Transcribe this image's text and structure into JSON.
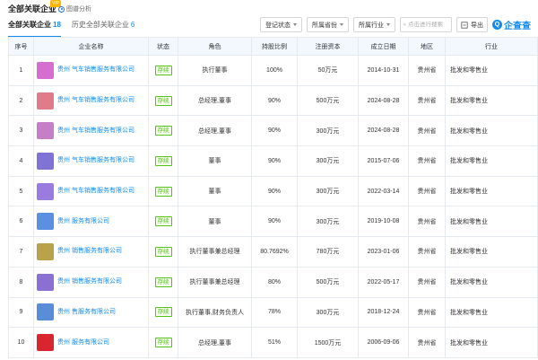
{
  "header": {
    "title": "全部关联企业",
    "vip_badge": "VIP",
    "analysis_label": "图谱分析"
  },
  "tabs": [
    {
      "label": "全部关联企业",
      "count": "18"
    },
    {
      "label": "历史全部关联企业",
      "count": "6"
    }
  ],
  "filters": {
    "status": "登记状态",
    "industry_all": "所属省份",
    "industry": "所属行业",
    "search_placeholder": "点击进行搜索",
    "export": "导出",
    "brand": "企查查"
  },
  "table": {
    "columns": [
      "序号",
      "企业名称",
      "状态",
      "角色",
      "持股比例",
      "注册资本",
      "成立日期",
      "地区",
      "行业"
    ],
    "rows": [
      {
        "no": "1",
        "name": "贵州                气车销售服务有限公司",
        "status": "存续",
        "role": "执行董事",
        "ratio": "100%",
        "capital": "50万元",
        "date": "2014-10-31",
        "region": "贵州省",
        "industry": "批发和零售业",
        "logo": "#d46fcf"
      },
      {
        "no": "2",
        "name": "贵州                气车销售服务有限公司",
        "status": "存续",
        "role": "总经理,董事",
        "ratio": "90%",
        "capital": "500万元",
        "date": "2024-08-28",
        "region": "贵州省",
        "industry": "批发和零售业",
        "logo": "#e07c8a"
      },
      {
        "no": "3",
        "name": "贵州                气车销售服务有限公司",
        "status": "存续",
        "role": "总经理,董事",
        "ratio": "90%",
        "capital": "300万元",
        "date": "2024-08-28",
        "region": "贵州省",
        "industry": "批发和零售业",
        "logo": "#c57fc9"
      },
      {
        "no": "4",
        "name": "贵州                气车销售服务有限公司",
        "status": "存续",
        "role": "董事",
        "ratio": "90%",
        "capital": "300万元",
        "date": "2015-07-06",
        "region": "贵州省",
        "industry": "批发和零售业",
        "logo": "#7f73d6"
      },
      {
        "no": "5",
        "name": "贵州                气车销售服务有限公司",
        "status": "存续",
        "role": "董事",
        "ratio": "90%",
        "capital": "300万元",
        "date": "2022-03-14",
        "region": "贵州省",
        "industry": "批发和零售业",
        "logo": "#9a7be0"
      },
      {
        "no": "6",
        "name": "贵州                服务有限公司",
        "status": "存续",
        "role": "董事",
        "ratio": "90%",
        "capital": "300万元",
        "date": "2019-10-08",
        "region": "贵州省",
        "industry": "批发和零售业",
        "logo": "#5b8fe0"
      },
      {
        "no": "7",
        "name": "贵州              销售服务有限公司",
        "status": "存续",
        "role": "执行董事兼总经理",
        "ratio": "80.7692%",
        "capital": "780万元",
        "date": "2023-01-06",
        "region": "贵州省",
        "industry": "批发和零售业",
        "logo": "#b8a24a"
      },
      {
        "no": "8",
        "name": "贵州              销售服务有限公司",
        "status": "存续",
        "role": "执行董事兼总经理",
        "ratio": "80%",
        "capital": "500万元",
        "date": "2022-05-17",
        "region": "贵州省",
        "industry": "批发和零售业",
        "logo": "#8b6fd3"
      },
      {
        "no": "9",
        "name": "贵州              售服务有限公司",
        "status": "存续",
        "role": "执行董事,财务负责人",
        "ratio": "78%",
        "capital": "300万元",
        "date": "2018-12-24",
        "region": "贵州省",
        "industry": "批发和零售业",
        "logo": "#5a8dd8"
      },
      {
        "no": "10",
        "name": "贵州              服务有限公司",
        "status": "存续",
        "role": "总经理,董事",
        "ratio": "51%",
        "capital": "1500万元",
        "date": "2006-09-06",
        "region": "贵州省",
        "industry": "批发和零售业",
        "logo": "#d9252e"
      }
    ]
  }
}
